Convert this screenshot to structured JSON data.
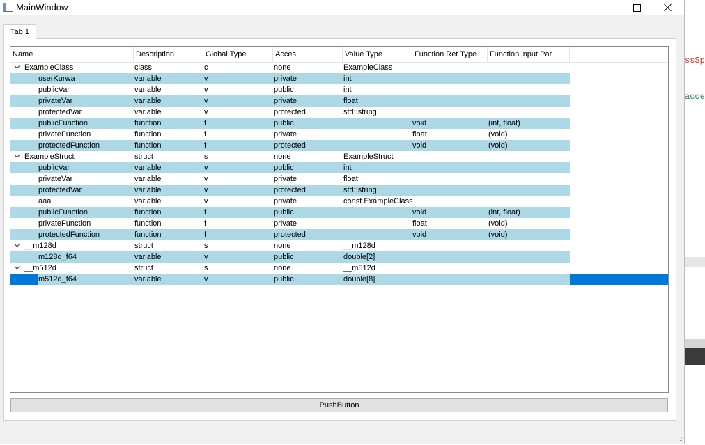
{
  "window": {
    "title": "MainWindow"
  },
  "tabs": [
    {
      "label": "Tab 1"
    }
  ],
  "tree": {
    "columns": [
      "Name",
      "Description",
      "Global Type",
      "Acces",
      "Value Type",
      "Function Ret Type",
      "Function input Par"
    ],
    "rows": [
      {
        "level": 0,
        "expanded": true,
        "name": "ExampleClass",
        "description": "class",
        "gtype": "c",
        "access": "none",
        "vtype": "ExampleClass",
        "ret": "",
        "params": ""
      },
      {
        "level": 1,
        "name": "userKurwa",
        "description": "variable",
        "gtype": "v",
        "access": "private",
        "vtype": "int",
        "ret": "",
        "params": ""
      },
      {
        "level": 1,
        "name": "publicVar",
        "description": "variable",
        "gtype": "v",
        "access": "public",
        "vtype": "int",
        "ret": "",
        "params": ""
      },
      {
        "level": 1,
        "name": "privateVar",
        "description": "variable",
        "gtype": "v",
        "access": "private",
        "vtype": "float",
        "ret": "",
        "params": ""
      },
      {
        "level": 1,
        "name": "protectedVar",
        "description": "variable",
        "gtype": "v",
        "access": "protected",
        "vtype": "std::string",
        "ret": "",
        "params": ""
      },
      {
        "level": 1,
        "name": "publicFunction",
        "description": "function",
        "gtype": "f",
        "access": "public",
        "vtype": "",
        "ret": "void",
        "params": "(int, float)"
      },
      {
        "level": 1,
        "name": "privateFunction",
        "description": "function",
        "gtype": "f",
        "access": "private",
        "vtype": "",
        "ret": "float",
        "params": "(void)"
      },
      {
        "level": 1,
        "name": "protectedFunction",
        "description": "function",
        "gtype": "f",
        "access": "protected",
        "vtype": "",
        "ret": "void",
        "params": "(void)"
      },
      {
        "level": 0,
        "expanded": true,
        "name": "ExampleStruct",
        "description": "struct",
        "gtype": "s",
        "access": "none",
        "vtype": "ExampleStruct",
        "ret": "",
        "params": ""
      },
      {
        "level": 1,
        "name": "publicVar",
        "description": "variable",
        "gtype": "v",
        "access": "public",
        "vtype": "int",
        "ret": "",
        "params": ""
      },
      {
        "level": 1,
        "name": "privateVar",
        "description": "variable",
        "gtype": "v",
        "access": "private",
        "vtype": "float",
        "ret": "",
        "params": ""
      },
      {
        "level": 1,
        "name": "protectedVar",
        "description": "variable",
        "gtype": "v",
        "access": "protected",
        "vtype": "std::string",
        "ret": "",
        "params": ""
      },
      {
        "level": 1,
        "name": "aaa",
        "description": "variable",
        "gtype": "v",
        "access": "private",
        "vtype": "const ExampleClass",
        "ret": "",
        "params": ""
      },
      {
        "level": 1,
        "name": "publicFunction",
        "description": "function",
        "gtype": "f",
        "access": "public",
        "vtype": "",
        "ret": "void",
        "params": "(int, float)"
      },
      {
        "level": 1,
        "name": "privateFunction",
        "description": "function",
        "gtype": "f",
        "access": "private",
        "vtype": "",
        "ret": "float",
        "params": "(void)"
      },
      {
        "level": 1,
        "name": "protectedFunction",
        "description": "function",
        "gtype": "f",
        "access": "protected",
        "vtype": "",
        "ret": "void",
        "params": "(void)"
      },
      {
        "level": 0,
        "expanded": true,
        "name": "__m128d",
        "description": "struct",
        "gtype": "s",
        "access": "none",
        "vtype": "__m128d",
        "ret": "",
        "params": ""
      },
      {
        "level": 1,
        "name": "m128d_f64",
        "description": "variable",
        "gtype": "v",
        "access": "public",
        "vtype": "double[2]",
        "ret": "",
        "params": ""
      },
      {
        "level": 0,
        "expanded": true,
        "name": "__m512d",
        "description": "struct",
        "gtype": "s",
        "access": "none",
        "vtype": "__m512d",
        "ret": "",
        "params": ""
      },
      {
        "level": 1,
        "selected": true,
        "name": "m512d_f64",
        "description": "variable",
        "gtype": "v",
        "access": "public",
        "vtype": "double[8]",
        "ret": "",
        "params": ""
      }
    ]
  },
  "push_button": {
    "label": "PushButton"
  },
  "background_window": {
    "snippet_1": "ssSpe",
    "snippet_2": "acces"
  },
  "colors": {
    "row_alt": "#add8e6",
    "selection": "#0078d7"
  }
}
